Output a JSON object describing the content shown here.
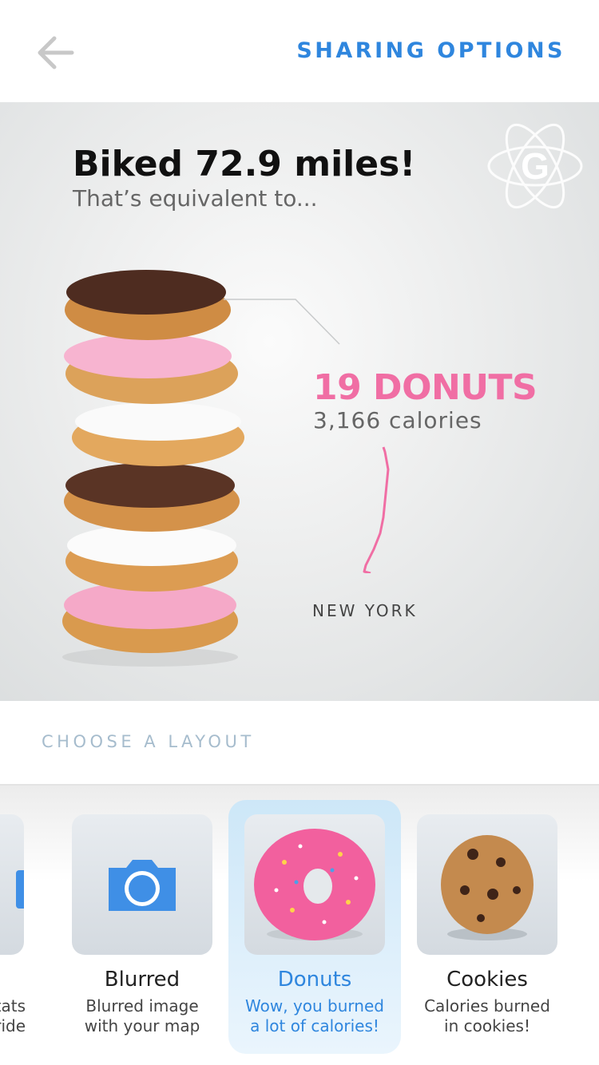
{
  "header": {
    "back_icon": "arrow-left-icon",
    "sharing_options": "SHARING OPTIONS"
  },
  "hero": {
    "title": "Biked 72.9 miles!",
    "subtitle": "That’s equivalent to...",
    "logo_letter": "G",
    "count": "19 DONUTS",
    "calories": "3,166 calories",
    "city": "NEW YORK",
    "accent_color": "#f06ea4"
  },
  "layout": {
    "heading": "CHOOSE A LAYOUT",
    "cards": [
      {
        "name": "",
        "desc_line1": "tats",
        "desc_line2": "ride"
      },
      {
        "name": "Blurred",
        "desc_line1": "Blurred image",
        "desc_line2": "with your map",
        "icon": "camera-icon"
      },
      {
        "name": "Donuts",
        "desc_line1": "Wow, you burned",
        "desc_line2": "a lot of calories!",
        "selected": true
      },
      {
        "name": "Cookies",
        "desc_line1": "Calories burned",
        "desc_line2": "in cookies!"
      }
    ]
  },
  "colors": {
    "blue": "#2f86de",
    "pink": "#f06ea4"
  }
}
